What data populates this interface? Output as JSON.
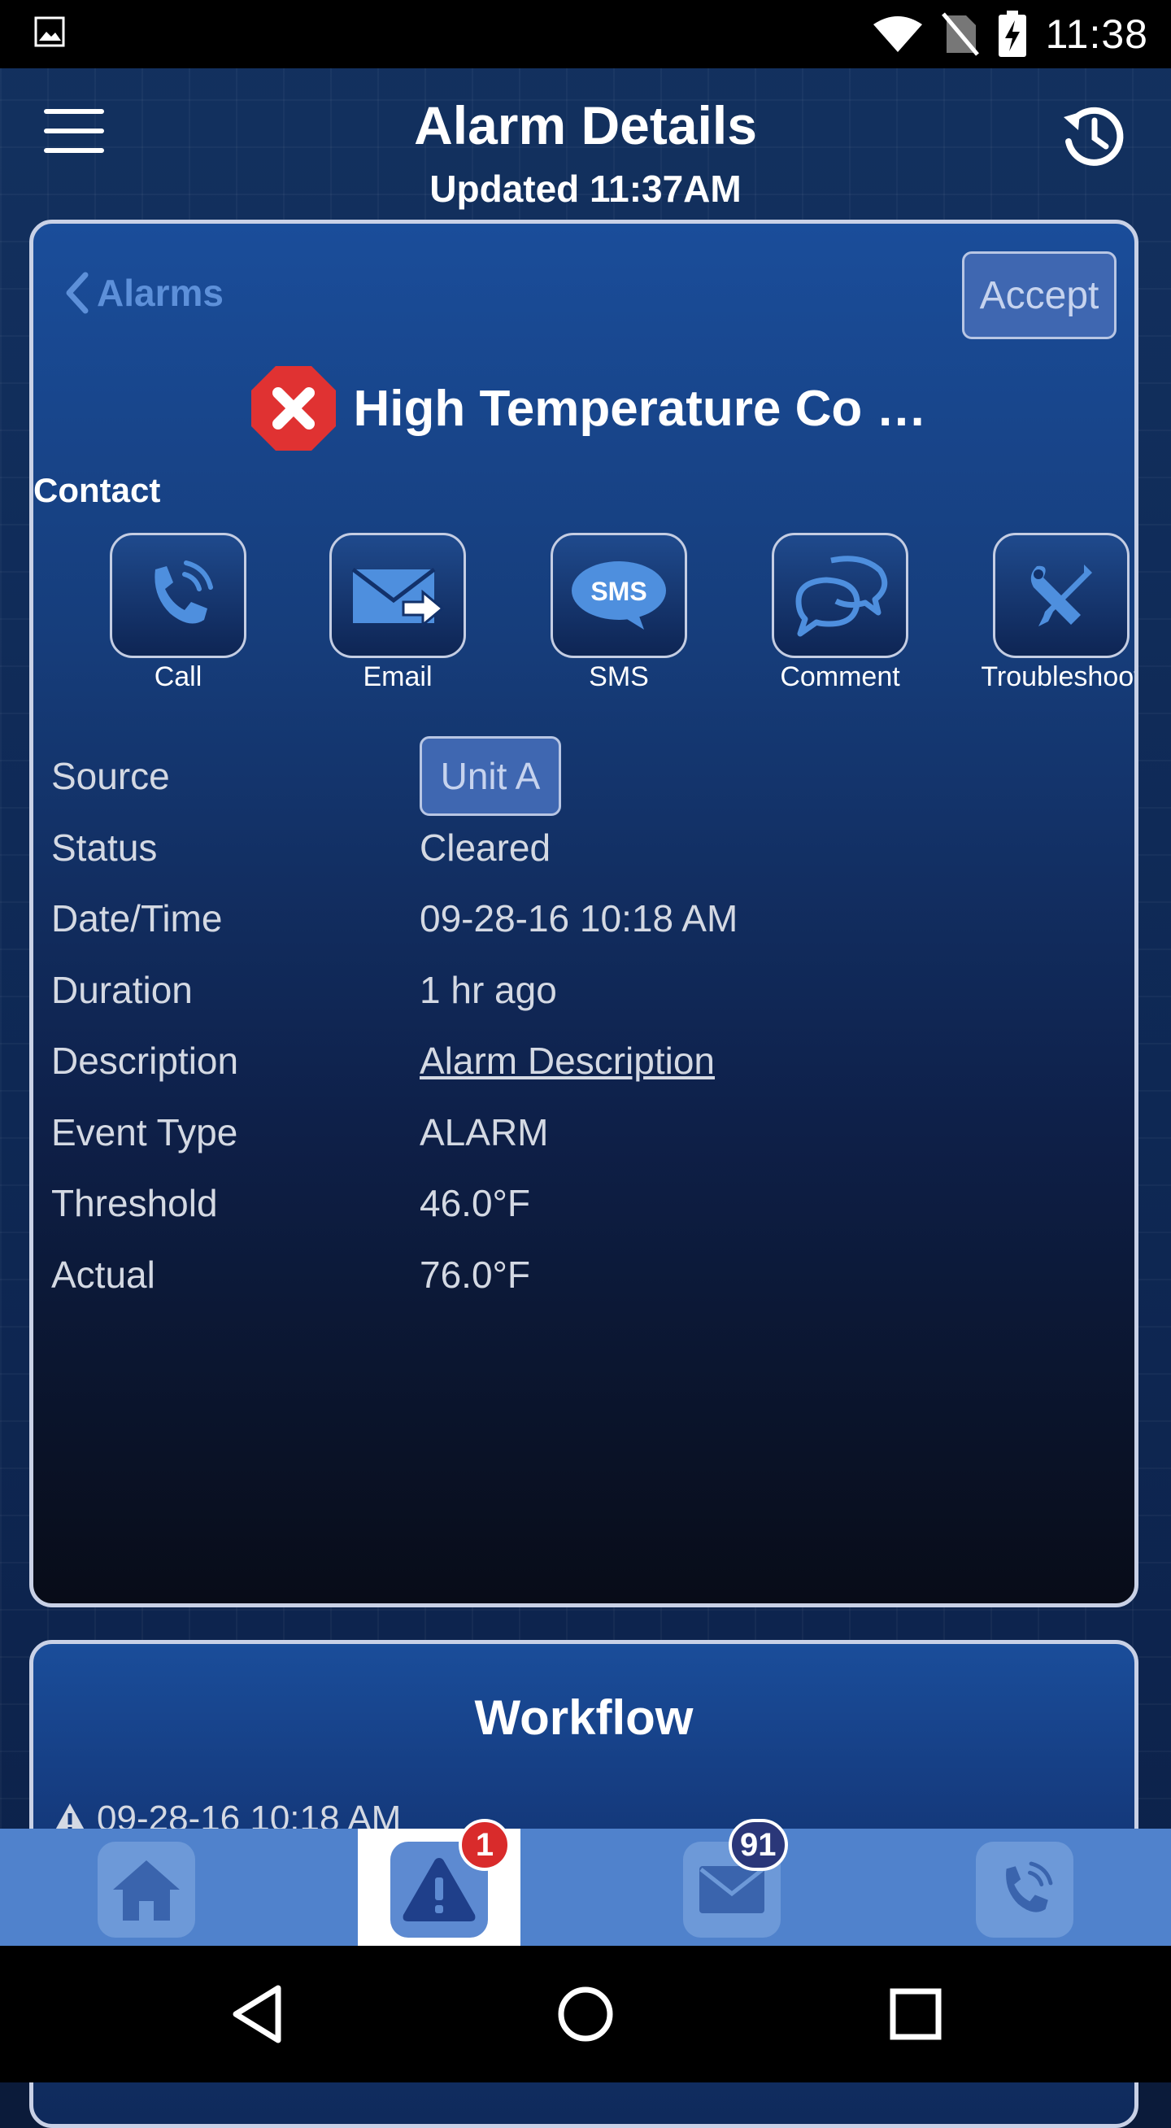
{
  "status_bar": {
    "time": "11:38",
    "icons": [
      "image-icon",
      "wifi-icon",
      "no-sim-icon",
      "battery-charging-icon"
    ]
  },
  "header": {
    "title": "Alarm Details",
    "updated": "Updated 11:37AM",
    "menu_icon": "hamburger-menu-icon",
    "history_icon": "history-icon"
  },
  "alarm": {
    "back_label": "Alarms",
    "accept_label": "Accept",
    "title": "High Temperature Co …",
    "severity_icon": "error-x-icon",
    "contact_label": "Contact",
    "contact_actions": [
      {
        "label": "Call",
        "icon": "phone-icon"
      },
      {
        "label": "Email",
        "icon": "email-forward-icon"
      },
      {
        "label": "SMS",
        "icon": "sms-bubble-icon",
        "icon_text": "SMS"
      },
      {
        "label": "Comment",
        "icon": "comment-bubbles-icon"
      },
      {
        "label": "Troubleshoot",
        "icon": "tools-icon"
      }
    ],
    "details": [
      {
        "label": "Source",
        "value": "Unit A"
      },
      {
        "label": "Status",
        "value": "Cleared"
      },
      {
        "label": "Date/Time",
        "value": "09-28-16 10:18 AM"
      },
      {
        "label": "Duration",
        "value": "1 hr ago"
      },
      {
        "label": "Description",
        "value": "Alarm Description"
      },
      {
        "label": "Event Type",
        "value": "ALARM"
      },
      {
        "label": "Threshold",
        "value": "46.0°F"
      },
      {
        "label": "Actual",
        "value": "76.0°F"
      }
    ]
  },
  "workflow": {
    "title": "Workflow",
    "entry": "09-28-16 10:18 AM"
  },
  "tabs": [
    {
      "name": "home",
      "icon": "home-icon",
      "badge": ""
    },
    {
      "name": "alarms",
      "icon": "warning-icon",
      "badge": "1"
    },
    {
      "name": "messages",
      "icon": "mail-icon",
      "badge": "91"
    },
    {
      "name": "call",
      "icon": "phone-icon",
      "badge": ""
    }
  ],
  "colors": {
    "accent": "#5082cc",
    "alarm_red": "#e03232",
    "badge_red": "#d92b2b",
    "badge_navy": "#2a3779"
  },
  "navigation": [
    "back-icon",
    "home-circle-icon",
    "recents-square-icon"
  ]
}
